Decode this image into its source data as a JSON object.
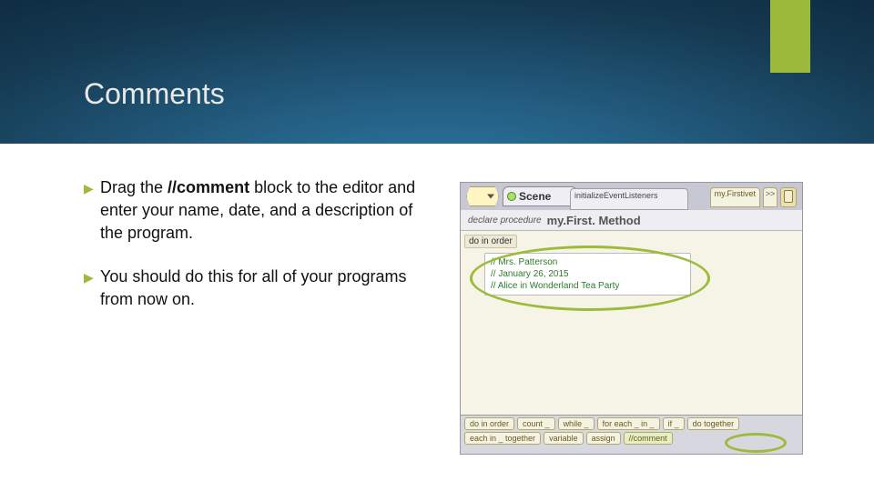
{
  "title": "Comments",
  "bullets": [
    {
      "pre": "Drag the ",
      "bold": "//comment",
      "post": " block to the editor and enter your name, date, and a description of the program."
    },
    {
      "text": "You should do this for all of your programs from now on."
    }
  ],
  "alice": {
    "sceneTab": "Scene",
    "initTab": "initializeEventListeners",
    "methodTab1": "my.Firstivet",
    "nextTab": ">>",
    "declare": "declare procedure",
    "methodName": "my.First. Method",
    "doInOrder": "do in order",
    "comments": [
      "// Mrs. Patterson",
      "// January 26, 2015",
      "// Alice in Wonderland Tea Party"
    ],
    "palette_row1": [
      "do in order",
      "count _",
      "while _",
      "for each _ in _",
      "if _",
      "do together"
    ],
    "palette_row2": [
      "each in _ together",
      "variable",
      "assign",
      "//comment"
    ]
  }
}
